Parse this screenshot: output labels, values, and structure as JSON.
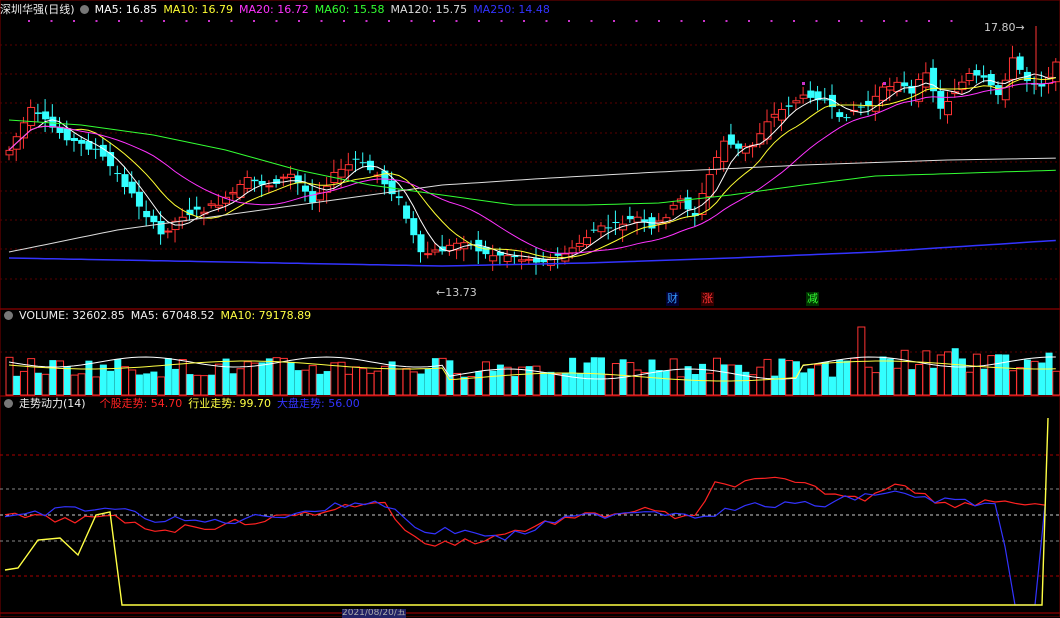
{
  "price_panel": {
    "stock_name": "深圳华强(日线)",
    "ma": [
      {
        "label": "MA5: 16.85",
        "color": "#ffffff"
      },
      {
        "label": "MA10: 16.79",
        "color": "#ffff33"
      },
      {
        "label": "MA20: 16.72",
        "color": "#ff33ff"
      },
      {
        "label": "MA60: 15.58",
        "color": "#33ff33"
      },
      {
        "label": "MA120: 15.75",
        "color": "#dddddd"
      },
      {
        "label": "MA250: 14.48",
        "color": "#3333ff"
      }
    ],
    "high_label": "17.80",
    "low_label": "13.73",
    "signals": [
      {
        "text": "财",
        "color": "#3399ff",
        "bg": "#000033"
      },
      {
        "text": "涨",
        "color": "#ff3333",
        "bg": "#330000"
      },
      {
        "text": "减",
        "color": "#33ff33",
        "bg": "#003300"
      }
    ]
  },
  "volume_panel": {
    "title": "VOLUME: 32602.85",
    "ma5": "MA5: 67048.52",
    "ma10": "MA10: 79178.89"
  },
  "trend_panel": {
    "title": "走势动力(14)",
    "stock": "个股走势: 54.70",
    "industry": "行业走势: 99.70",
    "market": "大盘走势: 56.00",
    "colors": {
      "stock": "#ff2222",
      "industry": "#ffff44",
      "market": "#3333ff"
    }
  },
  "bottom_axis": {
    "date_label": "2021/08/20/五"
  },
  "chart_data": [
    {
      "type": "candlestick",
      "title": "深圳华强(日线)",
      "high": 17.8,
      "low": 13.73,
      "series": [
        {
          "name": "MA5",
          "last": 16.85
        },
        {
          "name": "MA10",
          "last": 16.79
        },
        {
          "name": "MA20",
          "last": 16.72
        },
        {
          "name": "MA60",
          "last": 15.58
        },
        {
          "name": "MA120",
          "last": 15.75
        },
        {
          "name": "MA250",
          "last": 14.48
        }
      ]
    },
    {
      "type": "bar",
      "title": "VOLUME",
      "series": [
        {
          "name": "VOLUME",
          "last": 32602.85
        },
        {
          "name": "MA5",
          "last": 67048.52
        },
        {
          "name": "MA10",
          "last": 79178.89
        }
      ]
    },
    {
      "type": "line",
      "title": "走势动力(14)",
      "series": [
        {
          "name": "个股走势",
          "last": 54.7
        },
        {
          "name": "行业走势",
          "last": 99.7
        },
        {
          "name": "大盘走势",
          "last": 56.0
        }
      ]
    }
  ]
}
